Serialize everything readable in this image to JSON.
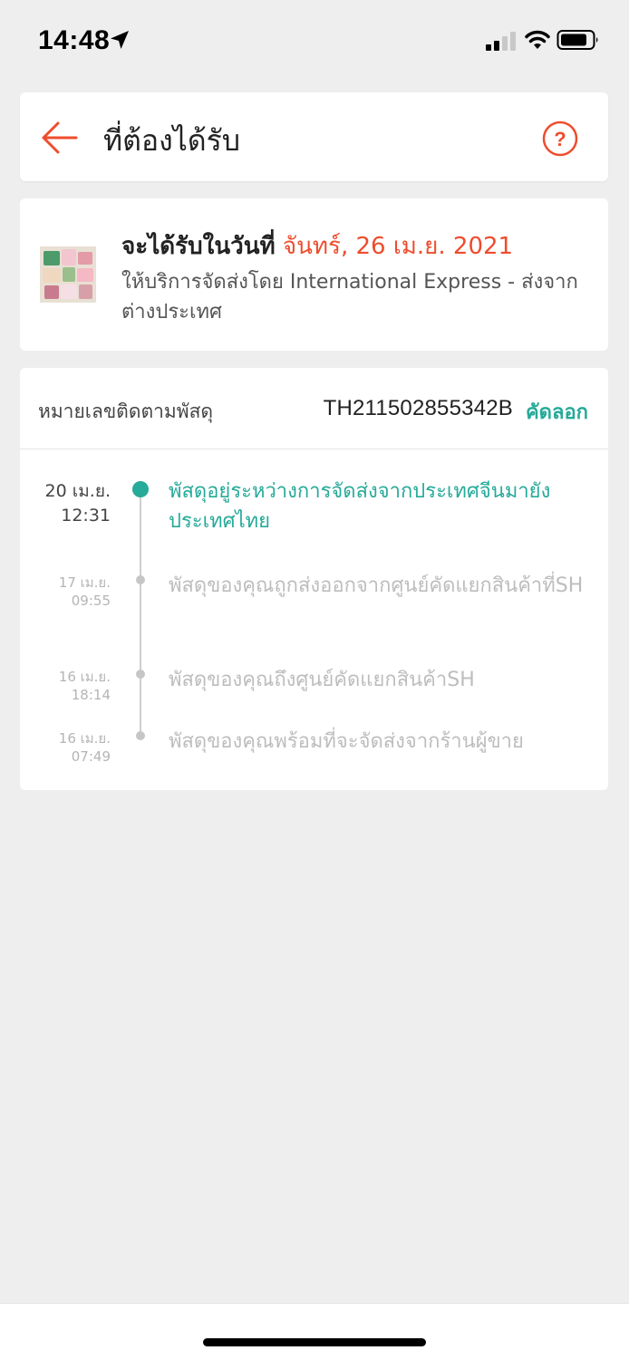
{
  "status_bar": {
    "time": "14:48",
    "icons": [
      "location-arrow-icon",
      "signal-icon",
      "wifi-icon",
      "battery-icon"
    ]
  },
  "header": {
    "title": "ที่ต้องได้รับ",
    "back_icon": "arrow-left-icon",
    "help_icon": "question-circle-icon"
  },
  "delivery": {
    "prefix": "จะได้รับในวันที่",
    "date": "จันทร์, 26 เม.ย. 2021",
    "service": "ให้บริการจัดส่งโดย International Express - ส่งจากต่างประเทศ"
  },
  "tracking": {
    "label": "หมายเลขติดตามพัสดุ",
    "number": "TH211502855342B",
    "copy_label": "คัดลอก",
    "events": [
      {
        "date": "20 เม.ย.",
        "time": "12:31",
        "text": "พัสดุอยู่ระหว่างการจัดส่งจากประเทศจีนมายังประเทศไทย",
        "active": true
      },
      {
        "date": "17 เม.ย.",
        "time": "09:55",
        "text": "พัสดุของคุณถูกส่งออกจากศูนย์คัดแยกสินค้าที่SH",
        "active": false
      },
      {
        "date": "16 เม.ย.",
        "time": "18:14",
        "text": "พัสดุของคุณถึงศูนย์คัดแยกสินค้าSH",
        "active": false
      },
      {
        "date": "16 เม.ย.",
        "time": "07:49",
        "text": "พัสดุของคุณพร้อมที่จะจัดส่งจากร้านผู้ขาย",
        "active": false
      }
    ]
  },
  "colors": {
    "accent_orange": "#ee4d2d",
    "accent_teal": "#26aa99",
    "background": "#eeeeee"
  }
}
